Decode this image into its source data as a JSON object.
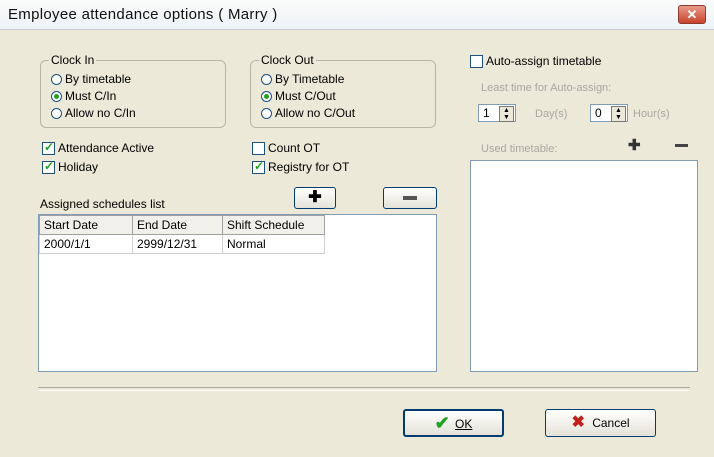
{
  "window": {
    "title": "Employee attendance options ( Marry )",
    "close_icon": "close-icon"
  },
  "clock_in": {
    "legend": "Clock In",
    "options": [
      {
        "label": "By timetable",
        "selected": false
      },
      {
        "label": "Must C/In",
        "selected": true
      },
      {
        "label": "Allow no C/In",
        "selected": false
      }
    ]
  },
  "clock_out": {
    "legend": "Clock Out",
    "options": [
      {
        "label": "By Timetable",
        "selected": false
      },
      {
        "label": "Must C/Out",
        "selected": true
      },
      {
        "label": "Allow no C/Out",
        "selected": false
      }
    ]
  },
  "checks": {
    "attendance_active": {
      "label": "Attendance Active",
      "checked": true
    },
    "holiday": {
      "label": "Holiday",
      "checked": true
    },
    "count_ot": {
      "label": "Count OT",
      "checked": false
    },
    "registry_ot": {
      "label": "Registry for OT",
      "checked": true
    }
  },
  "schedules": {
    "title": "Assigned schedules list",
    "add_icon": "plus-icon",
    "remove_icon": "minus-icon",
    "columns": [
      "Start Date",
      "End Date",
      "Shift Schedule"
    ],
    "rows": [
      [
        "2000/1/1",
        "2999/12/31",
        "Normal"
      ]
    ]
  },
  "auto_assign": {
    "label": "Auto-assign timetable",
    "checked": false,
    "least_time_label": "Least time for Auto-assign:",
    "day_value": "1",
    "day_unit": "Day(s)",
    "hour_value": "0",
    "hour_unit": "Hour(s)",
    "used_label": "Used timetable:",
    "add_icon": "plus-icon",
    "remove_icon": "minus-icon"
  },
  "buttons": {
    "ok_label": "OK",
    "cancel_label": "Cancel",
    "ok_icon": "check-icon",
    "cancel_icon": "x-icon"
  },
  "colors": {
    "check_green": "#21a121",
    "cancel_red": "#c0211b",
    "title_close": "#c8432c"
  }
}
